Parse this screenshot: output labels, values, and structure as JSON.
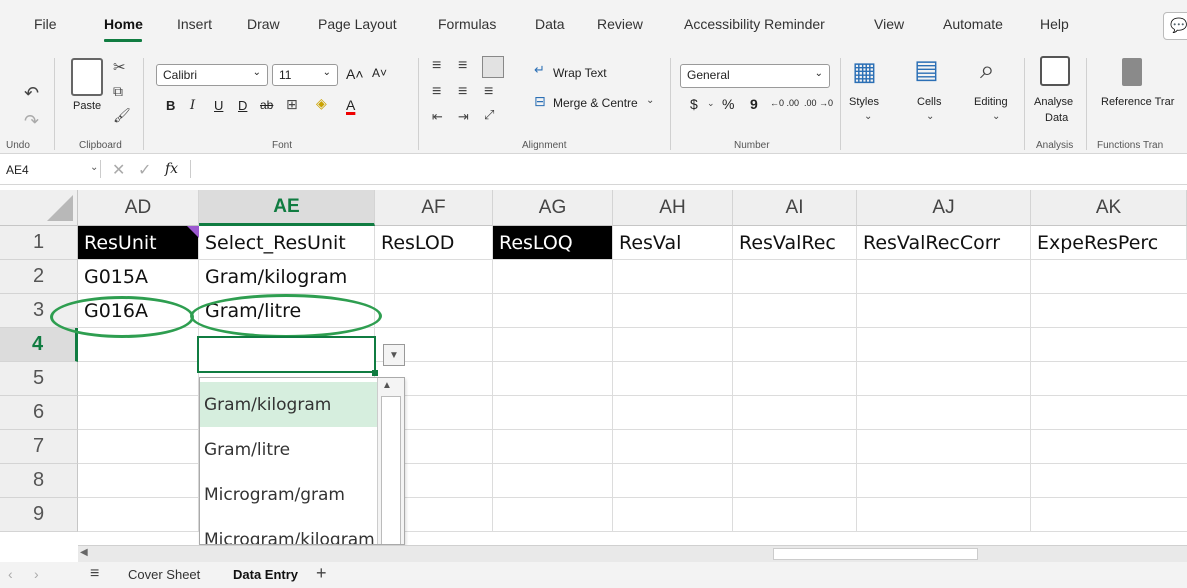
{
  "ribbon_tabs": [
    "File",
    "Home",
    "Insert",
    "Draw",
    "Page Layout",
    "Formulas",
    "Data",
    "Review",
    "Accessibility Reminder",
    "View",
    "Automate",
    "Help"
  ],
  "ribbon": {
    "undo_group": "Undo",
    "clipboard": {
      "paste": "Paste",
      "group": "Clipboard"
    },
    "font": {
      "name": "Calibri",
      "size": "11",
      "bold": "B",
      "italic": "I",
      "underline": "U",
      "double_underline": "D",
      "strike": "ab",
      "grow": "A˄",
      "shrink": "A˅",
      "font_color_letter": "A",
      "group": "Font"
    },
    "alignment": {
      "wrap_text": "Wrap Text",
      "merge_centre": "Merge & Centre",
      "group": "Alignment"
    },
    "number": {
      "format": "General",
      "currency": "$",
      "percent": "%",
      "comma": "9",
      "inc_decimal": "←0 .00",
      "dec_decimal": ".00 →0",
      "group": "Number"
    },
    "styles": "Styles",
    "cells": "Cells",
    "editing": "Editing",
    "analyse_line1": "Analyse",
    "analyse_line2": "Data",
    "analysis_group": "Analysis",
    "reference": "Reference Trar",
    "functions_group": "Functions Tran",
    "accent_color": "#107c41"
  },
  "formula_bar": {
    "name_box": "AE4",
    "fx": "fx",
    "value": ""
  },
  "columns": [
    "AD",
    "AE",
    "AF",
    "AG",
    "AH",
    "AI",
    "AJ",
    "AK"
  ],
  "selected_column": "AE",
  "rows": [
    "1",
    "2",
    "3",
    "4",
    "5",
    "6",
    "7",
    "8",
    "9"
  ],
  "selected_row": "4",
  "cells": {
    "r1": [
      "ResUnit",
      "Select_ResUnit",
      "ResLOD",
      "ResLOQ",
      "ResVal",
      "ResValRec",
      "ResValRecCorr",
      "ExpeResPerc"
    ],
    "r2": [
      "G015A",
      "Gram/kilogram"
    ],
    "r3": [
      "G016A",
      "Gram/litre"
    ]
  },
  "dropdown_options": [
    "Gram/kilogram",
    "Gram/litre",
    "Microgram/gram",
    "Microgram/kilogram"
  ],
  "dropdown_highlighted": "Gram/kilogram",
  "sheets": [
    "Cover Sheet",
    "Data Entry"
  ],
  "active_sheet": "Data Entry",
  "add_sheet": "+"
}
